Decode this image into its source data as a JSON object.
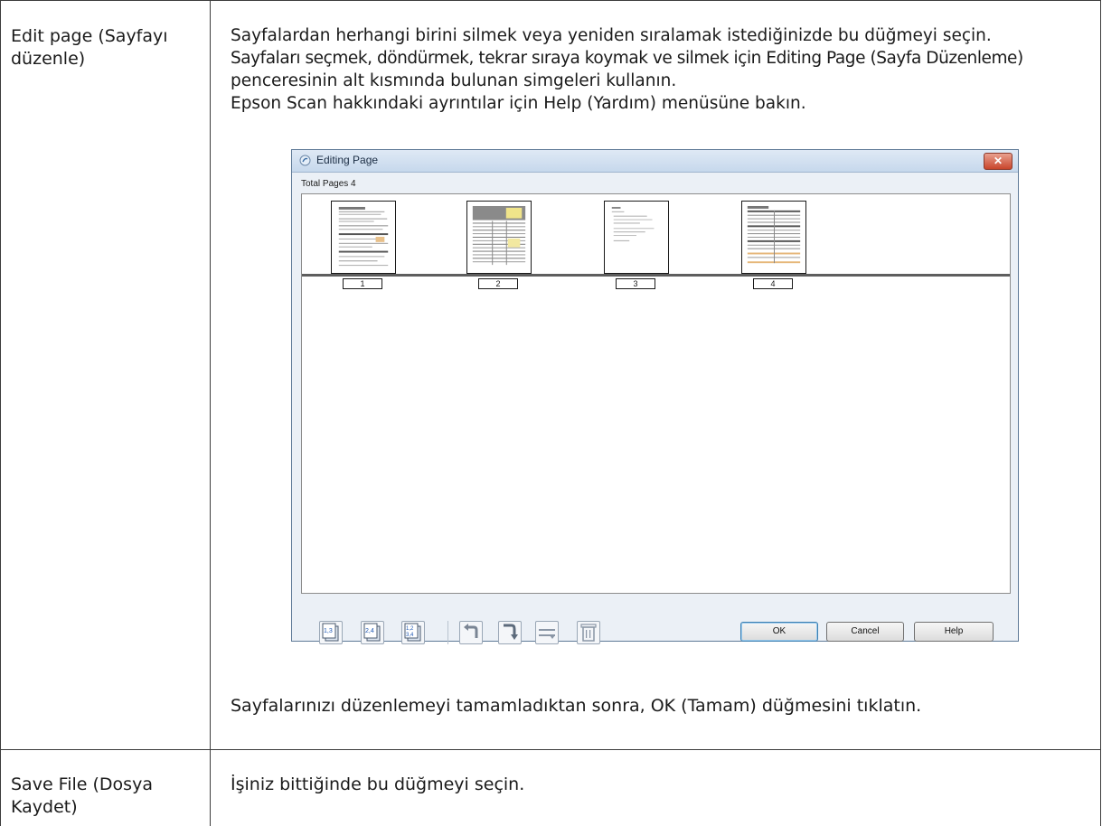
{
  "rows": [
    {
      "label": "Edit page (Sayfayı düzenle)",
      "label_lines": [
        "Edit page (Sayfayı",
        "düzenle)"
      ],
      "paragraphs": [
        "Sayfalardan herhangi birini silmek veya yeniden sıralamak istediğinizde bu düğmeyi seçin.",
        "Sayfaları seçmek, döndürmek, tekrar sıraya koymak ve silmek için Editing Page (Sayfa Düzenleme)",
        "penceresinin alt kısmında bulunan simgeleri kullanın.",
        "Epson Scan hakkındaki ayrıntılar için Help (Yardım) menüsüne bakın."
      ],
      "after_note": "Sayfalarınızı düzenlemeyi tamamladıktan sonra, OK (Tamam) düğmesini tıklatın."
    },
    {
      "label_lines": [
        "Save File (Dosya",
        "Kaydet)"
      ],
      "description": "İşiniz bittiğinde bu düğmeyi seçin."
    }
  ],
  "dialog": {
    "title": "Editing Page",
    "close_glyph": "✕",
    "total_pages_label": "Total Pages 4",
    "pages": [
      "1",
      "2",
      "3",
      "4"
    ],
    "toolbar_icons": [
      "select-odd-pages-icon",
      "select-even-pages-icon",
      "select-all-pages-icon",
      "rotate-left-icon",
      "rotate-right-icon",
      "reorder-pages-icon",
      "delete-page-icon"
    ],
    "buttons": {
      "ok": "OK",
      "cancel": "Cancel",
      "help": "Help"
    }
  }
}
